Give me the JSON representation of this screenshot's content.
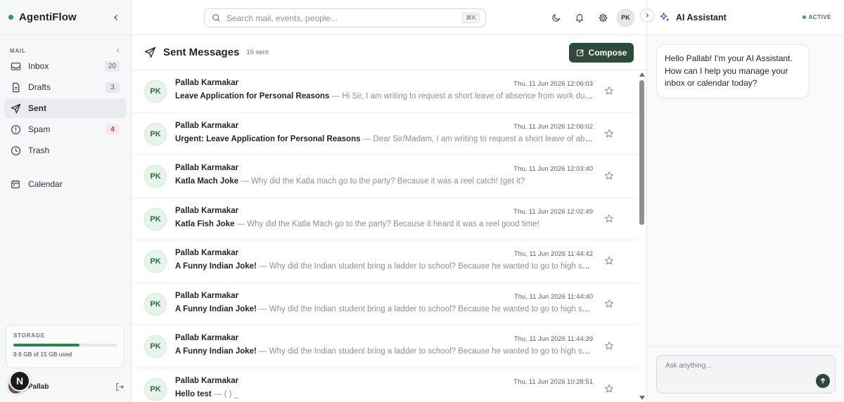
{
  "app": {
    "name": "AgentiFlow"
  },
  "sidebar": {
    "section_label": "MAIL",
    "items": [
      {
        "label": "Inbox",
        "icon": "inbox-icon",
        "badge": "20",
        "active": false
      },
      {
        "label": "Drafts",
        "icon": "file-icon",
        "badge": "3",
        "active": false
      },
      {
        "label": "Sent",
        "icon": "send-icon",
        "badge": "",
        "active": true
      },
      {
        "label": "Spam",
        "icon": "alert-circle-icon",
        "badge": "4",
        "active": false
      },
      {
        "label": "Trash",
        "icon": "clock-icon",
        "badge": "",
        "active": false
      }
    ],
    "calendar_label": "Calendar",
    "storage": {
      "label": "STORAGE",
      "text": "9.6 GB of 15 GB used",
      "used_fraction": 0.64
    },
    "user": {
      "name": "Pallab",
      "badge_letter": "N"
    }
  },
  "topbar": {
    "search_placeholder": "Search mail, events, people...",
    "shortcut": "⌘K",
    "avatar_initials": "PK"
  },
  "folder": {
    "title": "Sent Messages",
    "count": "16 sent",
    "compose_label": "Compose"
  },
  "messages": [
    {
      "initials": "PK",
      "sender": "Pallab Karmakar",
      "date": "Thu, 11 Jun 2026 12:06:03",
      "subject": "Leave Application for Personal Reasons",
      "sep": " — ",
      "snippet": "Hi Sir, I am writing to request a short leave of absence from work due to some personal reasons."
    },
    {
      "initials": "PK",
      "sender": "Pallab Karmakar",
      "date": "Thu, 11 Jun 2026 12:06:02",
      "subject": "Urgent: Leave Application for Personal Reasons",
      "sep": " — ",
      "snippet": "Dear Sir/Madam, I am writing to request a short leave of absence from work."
    },
    {
      "initials": "PK",
      "sender": "Pallab Karmakar",
      "date": "Thu, 11 Jun 2026 12:03:40",
      "subject": "Katla Mach Joke",
      "sep": " — ",
      "snippet": "Why did the Katla mach go to the party? Because it was a reel catch! (get it?"
    },
    {
      "initials": "PK",
      "sender": "Pallab Karmakar",
      "date": "Thu, 11 Jun 2026 12:02:49",
      "subject": "Katla Fish Joke",
      "sep": " — ",
      "snippet": "Why did the Katla Mach go to the party? Because it heard it was a reel good time!"
    },
    {
      "initials": "PK",
      "sender": "Pallab Karmakar",
      "date": "Thu, 11 Jun 2026 11:44:42",
      "subject": "A Funny Indian Joke!",
      "sep": " — ",
      "snippet": "Why did the Indian student bring a ladder to school? Because he wanted to go to high school!"
    },
    {
      "initials": "PK",
      "sender": "Pallab Karmakar",
      "date": "Thu, 11 Jun 2026 11:44:40",
      "subject": "A Funny Indian Joke!",
      "sep": " — ",
      "snippet": "Why did the Indian student bring a ladder to school? Because he wanted to go to high school!"
    },
    {
      "initials": "PK",
      "sender": "Pallab Karmakar",
      "date": "Thu, 11 Jun 2026 11:44:39",
      "subject": "A Funny Indian Joke!",
      "sep": " — ",
      "snippet": "Why did the Indian student bring a ladder to school? Because he wanted to go to high school!"
    },
    {
      "initials": "PK",
      "sender": "Pallab Karmakar",
      "date": "Thu, 11 Jun 2026 10:28:51",
      "subject": "Hello test",
      "sep": " — ",
      "snippet": "( ) _"
    }
  ],
  "assistant": {
    "title": "AI Assistant",
    "status": "ACTIVE",
    "greeting": "Hello Pallab! I'm your AI Assistant. How can I help you manage your inbox or calendar today?",
    "input_placeholder": "Ask anything..."
  },
  "colors": {
    "accent": "#2e4a3a",
    "active_dot": "#22a05a",
    "spam_badge": "#d33a3a"
  }
}
